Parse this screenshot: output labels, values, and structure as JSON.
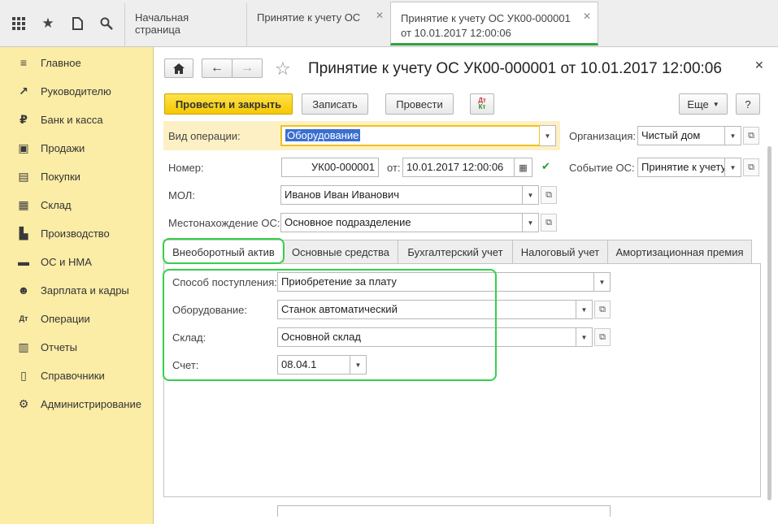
{
  "topbar": {
    "icons": [
      "apps-grid-icon",
      "star-icon",
      "history-icon",
      "search-icon"
    ],
    "tabs": [
      {
        "label": "Начальная страница"
      },
      {
        "label": "Принятие к учету ОС"
      },
      {
        "label_line1": "Принятие к учету ОС УК00-000001",
        "label_line2": "от 10.01.2017 12:00:06"
      }
    ]
  },
  "sidebar": {
    "items": [
      {
        "label": "Главное",
        "icon": "menu-icon",
        "glyph": "≡"
      },
      {
        "label": "Руководителю",
        "icon": "trend-icon",
        "glyph": "↗"
      },
      {
        "label": "Банк и касса",
        "icon": "ruble-icon",
        "glyph": "₽"
      },
      {
        "label": "Продажи",
        "icon": "bag-icon",
        "glyph": "▣"
      },
      {
        "label": "Покупки",
        "icon": "cart-icon",
        "glyph": "▤"
      },
      {
        "label": "Склад",
        "icon": "warehouse-icon",
        "glyph": "▦"
      },
      {
        "label": "Производство",
        "icon": "factory-icon",
        "glyph": "▙"
      },
      {
        "label": "ОС и НМА",
        "icon": "truck-icon",
        "glyph": "▬"
      },
      {
        "label": "Зарплата и кадры",
        "icon": "people-icon",
        "glyph": "☻"
      },
      {
        "label": "Операции",
        "icon": "dt-kt-icon",
        "glyph": "Дт"
      },
      {
        "label": "Отчеты",
        "icon": "bar-chart-icon",
        "glyph": "▥"
      },
      {
        "label": "Справочники",
        "icon": "book-icon",
        "glyph": "▯"
      },
      {
        "label": "Администрирование",
        "icon": "gear-icon",
        "glyph": "⚙"
      }
    ]
  },
  "doc": {
    "title": "Принятие к учету ОС УК00-000001 от 10.01.2017 12:00:06",
    "buttons": {
      "post_close": "Провести и закрыть",
      "save": "Записать",
      "post": "Провести",
      "more": "Еще",
      "help": "?"
    },
    "fields": {
      "operation_type_label": "Вид операции:",
      "operation_type_value": "Оборудование",
      "organization_label": "Организация:",
      "organization_value": "Чистый дом",
      "number_label": "Номер:",
      "number_value": "УК00-000001",
      "date_label": "от:",
      "date_value": "10.01.2017 12:00:06",
      "event_label": "Событие ОС:",
      "event_value": "Принятие к учету",
      "mol_label": "МОЛ:",
      "mol_value": "Иванов Иван Иванович",
      "location_label": "Местонахождение ОС:",
      "location_value": "Основное подразделение"
    },
    "tabs": [
      {
        "label": "Внеоборотный актив"
      },
      {
        "label": "Основные средства"
      },
      {
        "label": "Бухгалтерский учет"
      },
      {
        "label": "Налоговый учет"
      },
      {
        "label": "Амортизационная премия"
      }
    ],
    "asset": {
      "receipt_label": "Способ поступления:",
      "receipt_value": "Приобретение за плату",
      "equipment_label": "Оборудование:",
      "equipment_value": "Станок автоматический",
      "warehouse_label": "Склад:",
      "warehouse_value": "Основной склад",
      "account_label": "Счет:",
      "account_value": "08.04.1"
    }
  },
  "colors": {
    "sidebar_bg": "#fbeca6",
    "primary_button": "#f5c800",
    "highlight_green": "#35d04a",
    "active_tab_underline": "#2fa33a"
  }
}
